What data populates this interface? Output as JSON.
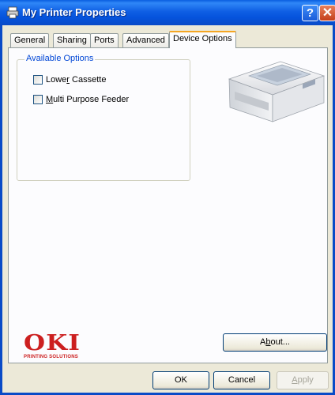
{
  "window": {
    "title": "My Printer Properties",
    "help_label": "?",
    "close_label": "✕",
    "title_icon": "printer-icon"
  },
  "tabs": [
    {
      "label": "General",
      "active": false
    },
    {
      "label": "Sharing",
      "active": false
    },
    {
      "label": "Ports",
      "active": false
    },
    {
      "label": "Advanced",
      "active": false
    },
    {
      "label": "Device Options",
      "active": true
    }
  ],
  "available_options": {
    "label": "Available Options",
    "items": [
      {
        "label_pre": "Lowe",
        "label_accel": "r",
        "label_post": " Cassette",
        "checked": false
      },
      {
        "label_pre": "",
        "label_accel": "M",
        "label_post": "ulti Purpose Feeder",
        "checked": false
      }
    ]
  },
  "brand": {
    "name": "OKI",
    "tagline": "PRINTING SOLUTIONS",
    "color": "#cc1f1f"
  },
  "buttons": {
    "about_pre": "A",
    "about_accel": "b",
    "about_post": "out...",
    "ok": "OK",
    "cancel": "Cancel",
    "apply_accel": "A",
    "apply_post": "pply"
  }
}
